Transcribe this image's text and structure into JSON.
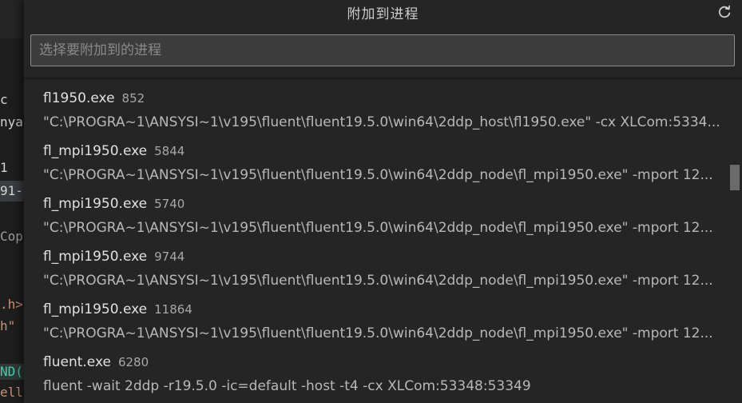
{
  "dialog": {
    "title": "附加到进程",
    "refresh_icon": "refresh-icon",
    "search": {
      "placeholder": "选择要附加到的进程",
      "value": ""
    }
  },
  "processes": [
    {
      "name": "fl1950.exe",
      "pid": "852",
      "command": "\"C:\\PROGRA~1\\ANSYSI~1\\v195\\fluent\\fluent19.5.0\\win64\\2ddp_host\\fl1950.exe\" -cx XLCom:5334..."
    },
    {
      "name": "fl_mpi1950.exe",
      "pid": "5844",
      "command": "\"C:\\PROGRA~1\\ANSYSI~1\\v195\\fluent\\fluent19.5.0\\win64\\2ddp_node\\fl_mpi1950.exe\" -mport 12..."
    },
    {
      "name": "fl_mpi1950.exe",
      "pid": "5740",
      "command": "\"C:\\PROGRA~1\\ANSYSI~1\\v195\\fluent\\fluent19.5.0\\win64\\2ddp_node\\fl_mpi1950.exe\" -mport 12..."
    },
    {
      "name": "fl_mpi1950.exe",
      "pid": "9744",
      "command": "\"C:\\PROGRA~1\\ANSYSI~1\\v195\\fluent\\fluent19.5.0\\win64\\2ddp_node\\fl_mpi1950.exe\" -mport 12..."
    },
    {
      "name": "fl_mpi1950.exe",
      "pid": "11864",
      "command": "\"C:\\PROGRA~1\\ANSYSI~1\\v195\\fluent\\fluent19.5.0\\win64\\2ddp_node\\fl_mpi1950.exe\" -mport 12..."
    },
    {
      "name": "fluent.exe",
      "pid": "6280",
      "command": "fluent -wait 2ddp -r19.5.0   -ic=default -host -t4  -cx XLCom:53348:53349"
    }
  ],
  "editor_fragments": [
    {
      "text": "c",
      "color": "#d4d4d4"
    },
    {
      "text": "nya",
      "color": "#d4d4d4"
    },
    {
      "text": "1",
      "color": "#d4d4d4"
    },
    {
      "text": "91-",
      "color": "#d4d4d4"
    },
    {
      "text": "Cop",
      "color": "#9e9e9e"
    },
    {
      "text": ".h>",
      "color": "#ce9178"
    },
    {
      "text": "h\"",
      "color": "#ce9178"
    },
    {
      "text": "ND(",
      "color": "#4ec9b0"
    },
    {
      "text": "ell",
      "color": "#ce9178"
    }
  ],
  "colors": {
    "panel_bg": "#252526",
    "input_bg": "#3c3c3c",
    "input_border": "#8c8c8c",
    "scrollbar": "#6b6b6b"
  }
}
